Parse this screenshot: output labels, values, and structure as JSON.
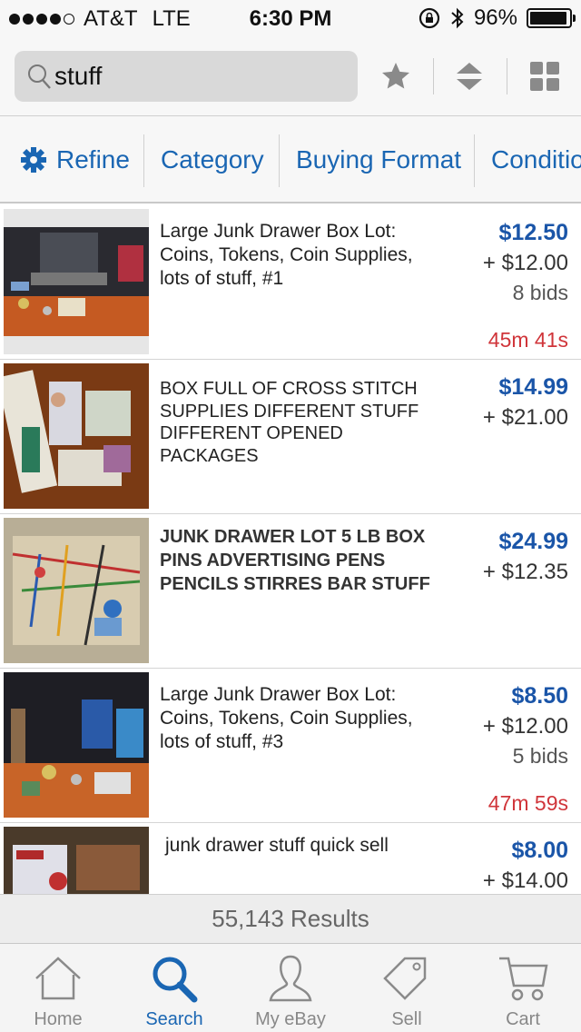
{
  "status_bar": {
    "carrier": "AT&T",
    "network": "LTE",
    "time": "6:30 PM",
    "battery": "96%",
    "signal_bars": 4
  },
  "search": {
    "query": "stuff",
    "icons": [
      "search-icon",
      "star-icon",
      "sort-icon",
      "grid-icon"
    ]
  },
  "filters": [
    {
      "label": "Refine",
      "icon": "gear-icon"
    },
    {
      "label": "Category"
    },
    {
      "label": "Buying Format"
    },
    {
      "label": "Conditio"
    }
  ],
  "listings": [
    {
      "title": "Large Junk Drawer Box Lot: Coins, Tokens, Coin Supplies, lots of stuff, #1",
      "price": "$12.50",
      "shipping": "+ $12.00",
      "bids": "8 bids",
      "time_left": "45m 41s"
    },
    {
      "title": "BOX FULL OF CROSS STITCH SUPPLIES DIFFERENT STUFF DIFFERENT OPENED PACKAGES",
      "price": "$14.99",
      "shipping": "+ $21.00",
      "bids": "",
      "time_left": ""
    },
    {
      "title": "JUNK DRAWER LOT  5 LB BOX   PINS  ADVERTISING PENS PENCILS STIRRES BAR STUFF",
      "price": "$24.99",
      "shipping": "+ $12.35",
      "bids": "",
      "time_left": ""
    },
    {
      "title": "Large Junk Drawer Box Lot: Coins, Tokens, Coin Supplies, lots of stuff, #3",
      "price": "$8.50",
      "shipping": "+ $12.00",
      "bids": "5 bids",
      "time_left": "47m 59s"
    },
    {
      "title": "junk drawer stuff quick sell",
      "price": "$8.00",
      "shipping": "+ $14.00",
      "bids": "",
      "time_left": ""
    }
  ],
  "results": "55,143 Results",
  "tabs": [
    {
      "label": "Home",
      "icon": "home-icon",
      "active": false
    },
    {
      "label": "Search",
      "icon": "search-icon",
      "active": true
    },
    {
      "label": "My eBay",
      "icon": "person-icon",
      "active": false
    },
    {
      "label": "Sell",
      "icon": "tag-icon",
      "active": false
    },
    {
      "label": "Cart",
      "icon": "cart-icon",
      "active": false
    }
  ],
  "colors": {
    "accent": "#1a66b3",
    "price": "#1a55a8",
    "time_left": "#d0353a"
  }
}
